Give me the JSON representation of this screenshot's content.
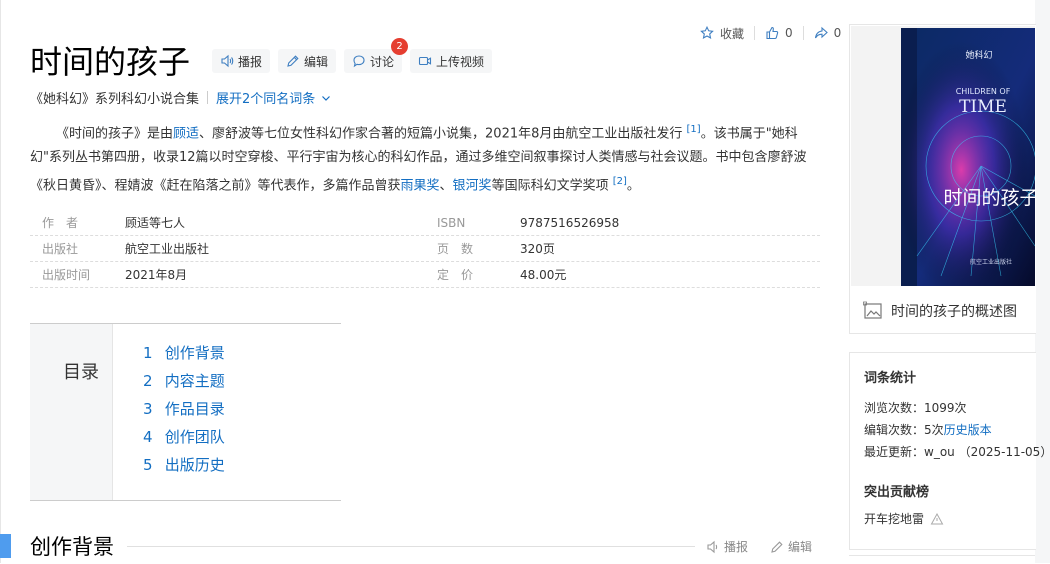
{
  "actions": {
    "favorite": "收藏",
    "likes": "0",
    "shares": "0"
  },
  "title": "时间的孩子",
  "title_buttons": {
    "play": "播报",
    "edit": "编辑",
    "discuss": "讨论",
    "discuss_badge": "2",
    "upload": "上传视频"
  },
  "subtitle": {
    "desc": "《她科幻》系列科幻小说合集",
    "expand": "展开2个同名词条"
  },
  "summary": {
    "p1_a": "《时间的孩子》是由",
    "p1_link1": "顾适",
    "p1_b": "、廖舒波等七位女性科幻作家合著的短篇小说集，2021年8月由航空工业出版社发行",
    "ref1": "[1]",
    "p1_c": "。该书属于\"她科幻\"系列丛书第四册，收录12篇以时空穿梭、平行宇宙为核心的科幻作品，通过多维空间叙事探讨人类情感与社会议题。书中包含廖舒波《秋日黄昏》、程婧波《赶在陷落之前》等代表作，多篇作品曾获",
    "p1_link2": "雨果奖",
    "p1_d": "、",
    "p1_link3": "银河奖",
    "p1_e": "等国际科幻文学奖项",
    "ref2": "[2]",
    "p1_f": "。"
  },
  "info": [
    {
      "k1": "作　者",
      "v1": "顾适等七人",
      "k2": "ISBN",
      "v2": "9787516526958"
    },
    {
      "k1": "出版社",
      "v1": "航空工业出版社",
      "k2": "页　数",
      "v2": "320页"
    },
    {
      "k1": "出版时间",
      "v1": "2021年8月",
      "k2": "定　价",
      "v2": "48.00元"
    }
  ],
  "toc": {
    "label": "目录",
    "items": [
      {
        "n": "1",
        "t": "创作背景"
      },
      {
        "n": "2",
        "t": "内容主题"
      },
      {
        "n": "3",
        "t": "作品目录"
      },
      {
        "n": "4",
        "t": "创作团队"
      },
      {
        "n": "5",
        "t": "出版历史"
      }
    ]
  },
  "section": {
    "title": "创作背景",
    "play": "播报",
    "edit": "编辑"
  },
  "cover": {
    "caption": "时间的孩子的概述图",
    "series_label": "她科幻",
    "en_title_1": "CHILDREN OF",
    "en_title_2": "TIME",
    "cn_title": "时间的孩子",
    "publisher": "航空工业出版社"
  },
  "stats": {
    "title": "词条统计",
    "views": "浏览次数：1099次",
    "edits_label": "编辑次数：5次",
    "history_link": "历史版本",
    "updated": "最近更新：w_ou （2025-11-05）",
    "contrib_title": "突出贡献榜",
    "contributor": "开车挖地雷"
  },
  "colors": {
    "link": "#136ec2",
    "badge": "#e53e30",
    "section_mark": "#4f9cee"
  }
}
